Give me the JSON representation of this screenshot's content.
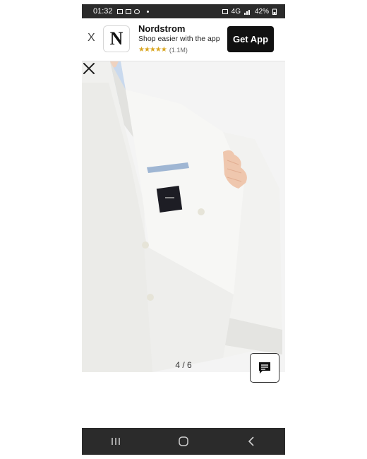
{
  "status_bar": {
    "time": "01:32",
    "battery": "42%",
    "network": "4G"
  },
  "app_banner": {
    "close_label": "X",
    "logo_letter": "N",
    "app_name": "Nordstrom",
    "tagline": "Shop easier with the app",
    "stars": "★★★★★",
    "review_count": "(1.1M)",
    "cta_label": "Get App",
    "accent_color": "#111111",
    "star_color": "#d9a520"
  },
  "image_viewer": {
    "counter": "4 / 6",
    "close_icon": "close-icon",
    "background": "#f3f3f3"
  },
  "chat_button": {
    "icon": "chat-icon"
  },
  "nav_bar": {
    "icons": [
      "recent-apps-icon",
      "home-icon",
      "back-icon"
    ]
  }
}
